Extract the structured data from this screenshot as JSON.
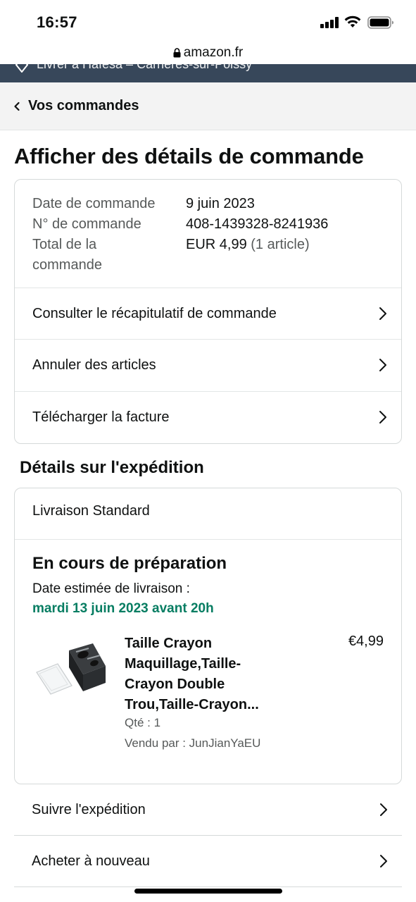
{
  "status_bar": {
    "time": "16:57"
  },
  "browser": {
    "url": "amazon.fr"
  },
  "header": {
    "delivery_text": "Livrer à Hafesa – Carrières-sur-Poissy"
  },
  "breadcrumb": {
    "label": "Vos commandes"
  },
  "page": {
    "title": "Afficher des détails de commande"
  },
  "order": {
    "rows": [
      {
        "label": "Date de commande",
        "value": "9 juin 2023",
        "suffix": ""
      },
      {
        "label": "N° de commande",
        "value": "408-1439328-8241936",
        "suffix": ""
      },
      {
        "label": "Total de la",
        "label2": "commande",
        "value": "EUR 4,99 ",
        "suffix": "(1 article)"
      }
    ],
    "links": [
      "Consulter le récapitulatif de commande",
      "Annuler des articles",
      "Télécharger la facture"
    ]
  },
  "shipping": {
    "section_title": "Détails sur l'expédition",
    "type": "Livraison Standard",
    "status": "En cours de préparation",
    "estimate_label": "Date estimée de livraison :",
    "estimate_date": "mardi 13 juin 2023 avant 20h",
    "status_color": "#067d62",
    "product": {
      "name": "Taille Crayon Maquillage,Taille-Crayon Double Trou,Taille-Crayon...",
      "price": "€4,99",
      "qty": "Qté : 1",
      "seller": "Vendu par : JunJianYaEU"
    }
  },
  "actions": [
    "Suivre l'expédition",
    "Acheter à nouveau"
  ]
}
